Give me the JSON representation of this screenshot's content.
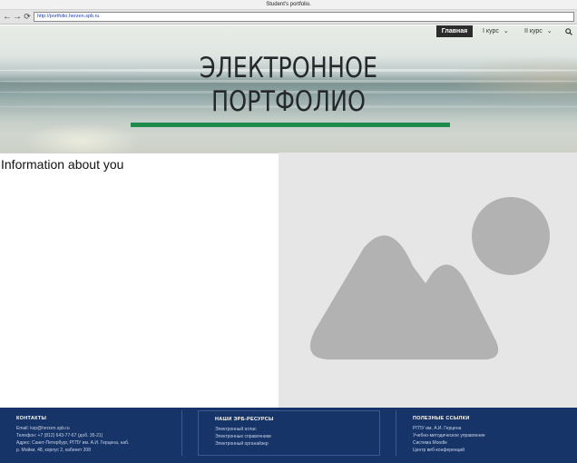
{
  "browser": {
    "title": "Student's portfolio.",
    "url": "http://portfolio.herzen.spb.ru",
    "back_icon": "arrow-left-icon",
    "forward_icon": "arrow-right-icon",
    "reload_icon": "reload-icon"
  },
  "site_menu": {
    "home": "Главная",
    "course1": "I курс",
    "course2": "II курс",
    "search_icon": "search-icon"
  },
  "hero": {
    "title_line1": "ЭЛЕКТРОННОЕ",
    "title_line2": "ПОРТФОЛИО",
    "accent_color": "#1f8a4d"
  },
  "main": {
    "info_title": "Information about you",
    "image_placeholder_icon": "image-placeholder-icon"
  },
  "footer": {
    "background": "#163468",
    "contacts": {
      "heading": "КОНТАКТЫ",
      "lines": [
        "Email: ksp@herzen.spb.ru",
        "Телефон: +7 (812) 643-77-67 (доб. 35-21)",
        "Адрес: Санкт-Петербург, РГПУ им. А.И. Герцена, наб.",
        "р. Мойки, 48, корпус 2, кабинет 208"
      ]
    },
    "resources": {
      "heading": "НАШИ ЭРБ-РЕСУРСЫ",
      "lines": [
        "Электронный атлас",
        "Электронные справочники",
        "Электронный органайзер"
      ]
    },
    "links": {
      "heading": "ПОЛЕЗНЫЕ ССЫЛКИ",
      "lines": [
        "РГПУ им. А.И. Герцена",
        "Учебно-методическое управление",
        "Система Moodle",
        "Центр веб-конференций"
      ]
    }
  }
}
